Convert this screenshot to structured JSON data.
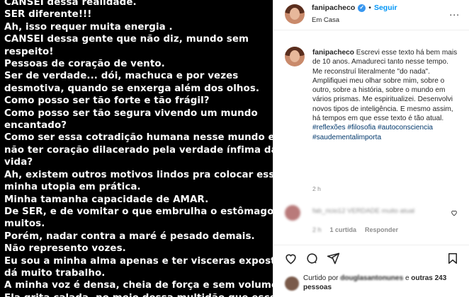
{
  "post_image": {
    "lines": [
      "CANSEI dessa realidade.",
      "SER diferente!!!",
      "Ah, isso requer muita energia .",
      "CANSEI dessa gente que não diz, mundo sem",
      "respeito!",
      "Pessoas de coração de vento.",
      "Ser de verdade... dói, machuca e por vezes",
      "desmotiva, quando se enxerga além dos olhos.",
      "Como posso ser tão forte e tão frágil?",
      "Como posso ser tão segura vivendo um mundo",
      "encantado?",
      "Como ser essa cotradição humana nesse mundo e",
      "não ter coração dilacerado pela verdade ínfima da",
      "vida?",
      "Ah, existem outros motivos lindos pra colocar essa",
      "minha  utopia em prática.",
      "Minha tamanha capacidade de AMAR.",
      "De SER, e de vomitar o que embrulha o estômago de",
      "muitos.",
      "Porém, nadar contra a maré é pesado demais.",
      "Não represento vozes.",
      "Eu sou a minha alma apenas e ter visceras expostas",
      "dá muito trabalho.",
      "A minha voz é densa, cheia de força e sem volume.",
      "Ela grita calada, no meio dessa multidão que escolhe"
    ]
  },
  "header": {
    "username": "fanipacheco",
    "verified_icon": "verified-badge-icon",
    "separator": "•",
    "follow_label": "Seguir",
    "location": "Em Casa",
    "more_label": "..."
  },
  "caption": {
    "username": "fanipacheco",
    "text": "Escrevi esse texto há bem mais de 10 anos. Amadureci tanto nesse tempo. Me reconstruí literalmente \"do nada\". Amplifiquei meu olhar sobre mim, sobre o outro, sobre a história, sobre o mundo em vários prismas. Me espiritualizei. Desenvolvi novos tipos de inteligência. E mesmo assim, há tempos em que esse texto é tão atual.",
    "hashtags": [
      "#reflexões",
      "#filosofia",
      "#autoconsciencia",
      "#saudementalimporta"
    ],
    "time": "2 h"
  },
  "comment": {
    "text": "fab_ricio12 VERDADE muito atual",
    "time": "2 h",
    "likes_label": "1 curtida",
    "reply_label": "Responder"
  },
  "actions": {
    "like_icon": "heart-icon",
    "comment_icon": "comment-icon",
    "share_icon": "share-icon",
    "save_icon": "bookmark-icon"
  },
  "likes": {
    "prefix": "Curtido por",
    "user": "douglasantonunes",
    "connector": "e",
    "others": "outras 243 pessoas"
  },
  "colors": {
    "link": "#0095f6",
    "hashtag": "#00376b",
    "muted": "#8e8e8e",
    "text": "#262626",
    "post_background": "#000000"
  }
}
